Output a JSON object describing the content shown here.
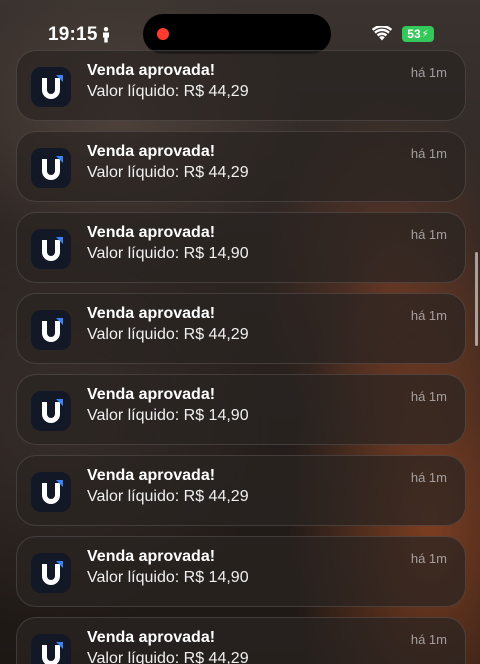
{
  "status_bar": {
    "time": "19:15",
    "battery_level": "53",
    "icons": [
      "person-icon",
      "recording-dot-icon",
      "wifi-icon",
      "battery-charging-icon"
    ],
    "colors": {
      "battery": "#34c759",
      "recording": "#ff3b30"
    }
  },
  "notifications": [
    {
      "title": "Venda aprovada!",
      "body": "Valor líquido: R$ 44,29",
      "time": "há 1m"
    },
    {
      "title": "Venda aprovada!",
      "body": "Valor líquido: R$ 44,29",
      "time": "há 1m"
    },
    {
      "title": "Venda aprovada!",
      "body": "Valor líquido: R$ 14,90",
      "time": "há 1m"
    },
    {
      "title": "Venda aprovada!",
      "body": "Valor líquido: R$ 44,29",
      "time": "há 1m"
    },
    {
      "title": "Venda aprovada!",
      "body": "Valor líquido: R$ 14,90",
      "time": "há 1m"
    },
    {
      "title": "Venda aprovada!",
      "body": "Valor líquido: R$ 44,29",
      "time": "há 1m"
    },
    {
      "title": "Venda aprovada!",
      "body": "Valor líquido: R$ 14,90",
      "time": "há 1m"
    },
    {
      "title": "Venda aprovada!",
      "body": "Valor líquido: R$ 44,29",
      "time": "há 1m"
    }
  ]
}
